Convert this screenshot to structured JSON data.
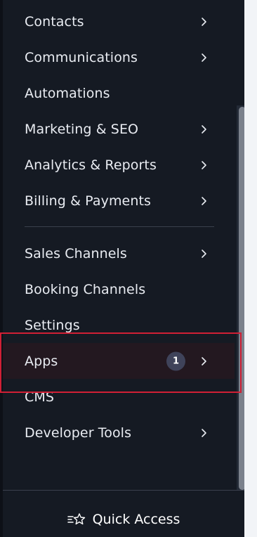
{
  "sidebar": {
    "items": [
      {
        "label": "Contacts",
        "chevron": true
      },
      {
        "label": "Communications",
        "chevron": true
      },
      {
        "label": "Automations",
        "chevron": false
      },
      {
        "label": "Marketing & SEO",
        "chevron": true
      },
      {
        "label": "Analytics & Reports",
        "chevron": true
      },
      {
        "label": "Billing & Payments",
        "chevron": true
      }
    ],
    "items2": [
      {
        "label": "Sales Channels",
        "chevron": true
      },
      {
        "label": "Booking Channels",
        "chevron": false
      },
      {
        "label": "Settings",
        "chevron": false
      },
      {
        "label": "Apps",
        "chevron": true,
        "badge": "1"
      },
      {
        "label": "CMS",
        "chevron": false
      },
      {
        "label": "Developer Tools",
        "chevron": true
      }
    ],
    "quick_access_label": "Quick Access"
  },
  "colors": {
    "background": "#151a23",
    "text": "#e9ecf2",
    "highlight_border": "#d01f35",
    "badge": "#3f435a"
  },
  "icons": {
    "chevron": "chevron-right-icon",
    "quick_access": "star-list-icon"
  }
}
